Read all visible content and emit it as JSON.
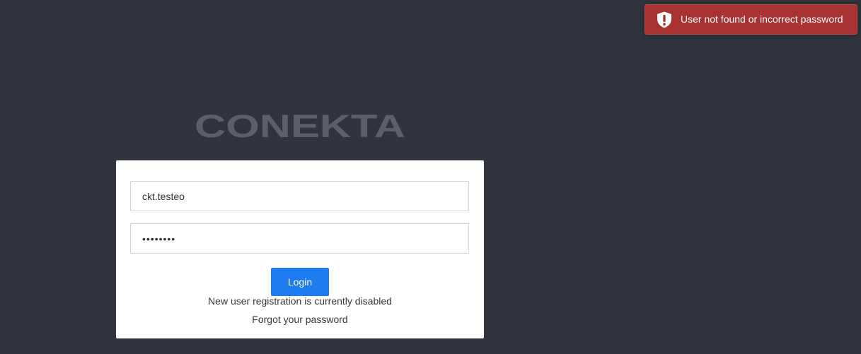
{
  "toast": {
    "message": "User not found or incorrect password",
    "icon": "shield-alert-icon",
    "background": "#a83232"
  },
  "logo": {
    "text": "CONEKTA",
    "color": "#5c5f64"
  },
  "login_form": {
    "username_value": "ckt.testeo",
    "password_value": "••••••••",
    "login_label": "Login",
    "registration_notice": "New user registration is currently disabled",
    "forgot_password_label": "Forgot your password"
  },
  "colors": {
    "page_background": "#30343d",
    "primary_button": "#1f7bf0",
    "card_background": "#ffffff"
  }
}
